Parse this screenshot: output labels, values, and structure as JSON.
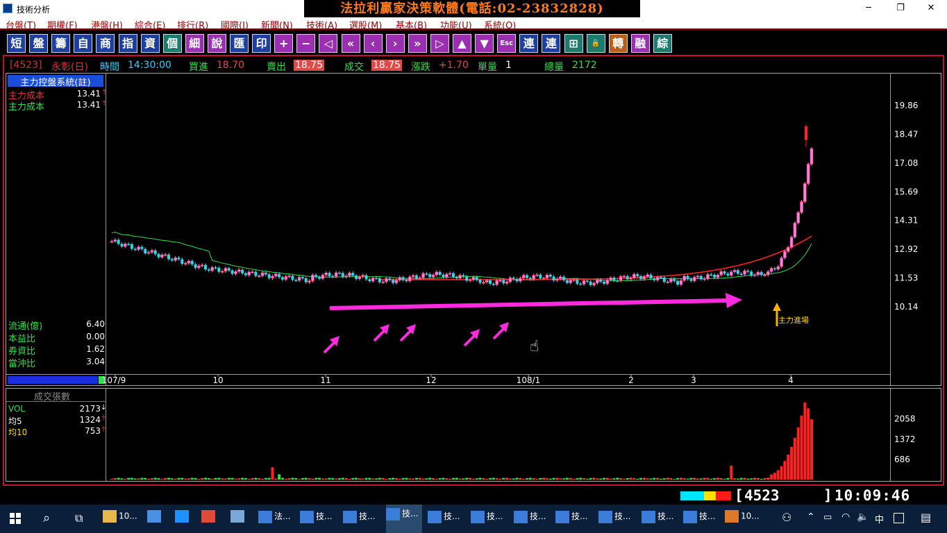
{
  "window": {
    "title": "技術分析",
    "banner": "法拉利贏家決策軟體(電話:02-23832828)",
    "min": "─",
    "max": "❐",
    "close": "✕"
  },
  "menu": [
    "台盤(T)",
    "期權(F)",
    "港盤(H)",
    "綜合(E)",
    "排行(R)",
    "國際(I)",
    "新聞(N)",
    "技術(A)",
    "選股(M)",
    "基本(B)",
    "功能(U)",
    "系統(O)"
  ],
  "toolbar": [
    "短",
    "盤",
    "籌",
    "自",
    "商",
    "指",
    "資",
    "個",
    "細",
    "說",
    "匯",
    "印",
    "+",
    "−",
    "◁",
    "«",
    "‹",
    "›",
    "»",
    "▷",
    "▲",
    "▼",
    "Esc",
    "連",
    "連",
    "⊞",
    "🔒",
    "轉",
    "融",
    "綜"
  ],
  "quote": {
    "code": "[4523]",
    "name": "永彰(日)",
    "time_label": "時間",
    "time": "14:30:00",
    "bid_label": "買進",
    "bid": "18.70",
    "ask_label": "賣出",
    "ask": "18.75",
    "last_label": "成交",
    "last": "18.75",
    "chg_label": "漲跌",
    "chg": "+1.70",
    "lot_label": "單量",
    "lot": "1",
    "vol_label": "總量",
    "vol": "2172"
  },
  "panel": {
    "header": "主力控盤系統(註)",
    "cost1_label": "主力成本",
    "cost1": "13.41",
    "cost2_label": "主力成本",
    "cost2": "13.41",
    "flow_label": "流通(億)",
    "flow": "6.40",
    "pe_label": "本益比",
    "pe": "0.00",
    "margin_label": "券資比",
    "margin": "1.62",
    "daytrade_label": "當沖比",
    "daytrade": "3.04",
    "vol_header": "成交張數",
    "vol_label": "VOL",
    "vol_val": "2173",
    "ma5_label": "均5",
    "ma5": "1324",
    "ma10_label": "均10",
    "ma10": "753"
  },
  "annotation": "主力進場",
  "chart_data": {
    "type": "candlestick",
    "y_ticks": [
      "19.86",
      "18.47",
      "17.08",
      "15.69",
      "14.31",
      "12.92",
      "11.53",
      "10.14"
    ],
    "x_ticks": [
      "107/9",
      "10",
      "11",
      "12",
      "108/1",
      "2",
      "3",
      "4"
    ],
    "vol_ticks": [
      "2058",
      "1372",
      "686"
    ],
    "last_close": 18.75,
    "main_cost": 13.41
  },
  "status": {
    "code": "4523",
    "clock": "10:09:46"
  },
  "taskbar": [
    {
      "label": "10...",
      "color": "#e8b84a"
    },
    {
      "label": "",
      "color": "#4a90e2"
    },
    {
      "label": "",
      "color": "#1e90ff"
    },
    {
      "label": "",
      "color": "#e04a3a"
    },
    {
      "label": "",
      "color": "#7aa8d8"
    },
    {
      "label": "法...",
      "color": "#3b7dd8"
    },
    {
      "label": "技...",
      "color": "#3b7dd8"
    },
    {
      "label": "技...",
      "color": "#3b7dd8"
    },
    {
      "label": "技...",
      "color": "#3b7dd8"
    },
    {
      "label": "技...",
      "color": "#3b7dd8"
    },
    {
      "label": "技...",
      "color": "#3b7dd8"
    },
    {
      "label": "技...",
      "color": "#3b7dd8"
    },
    {
      "label": "技...",
      "color": "#3b7dd8"
    },
    {
      "label": "技...",
      "color": "#3b7dd8"
    },
    {
      "label": "技...",
      "color": "#3b7dd8"
    },
    {
      "label": "技...",
      "color": "#3b7dd8"
    },
    {
      "label": "10...",
      "color": "#e0782a"
    }
  ],
  "tray": {
    "ime": "中"
  }
}
